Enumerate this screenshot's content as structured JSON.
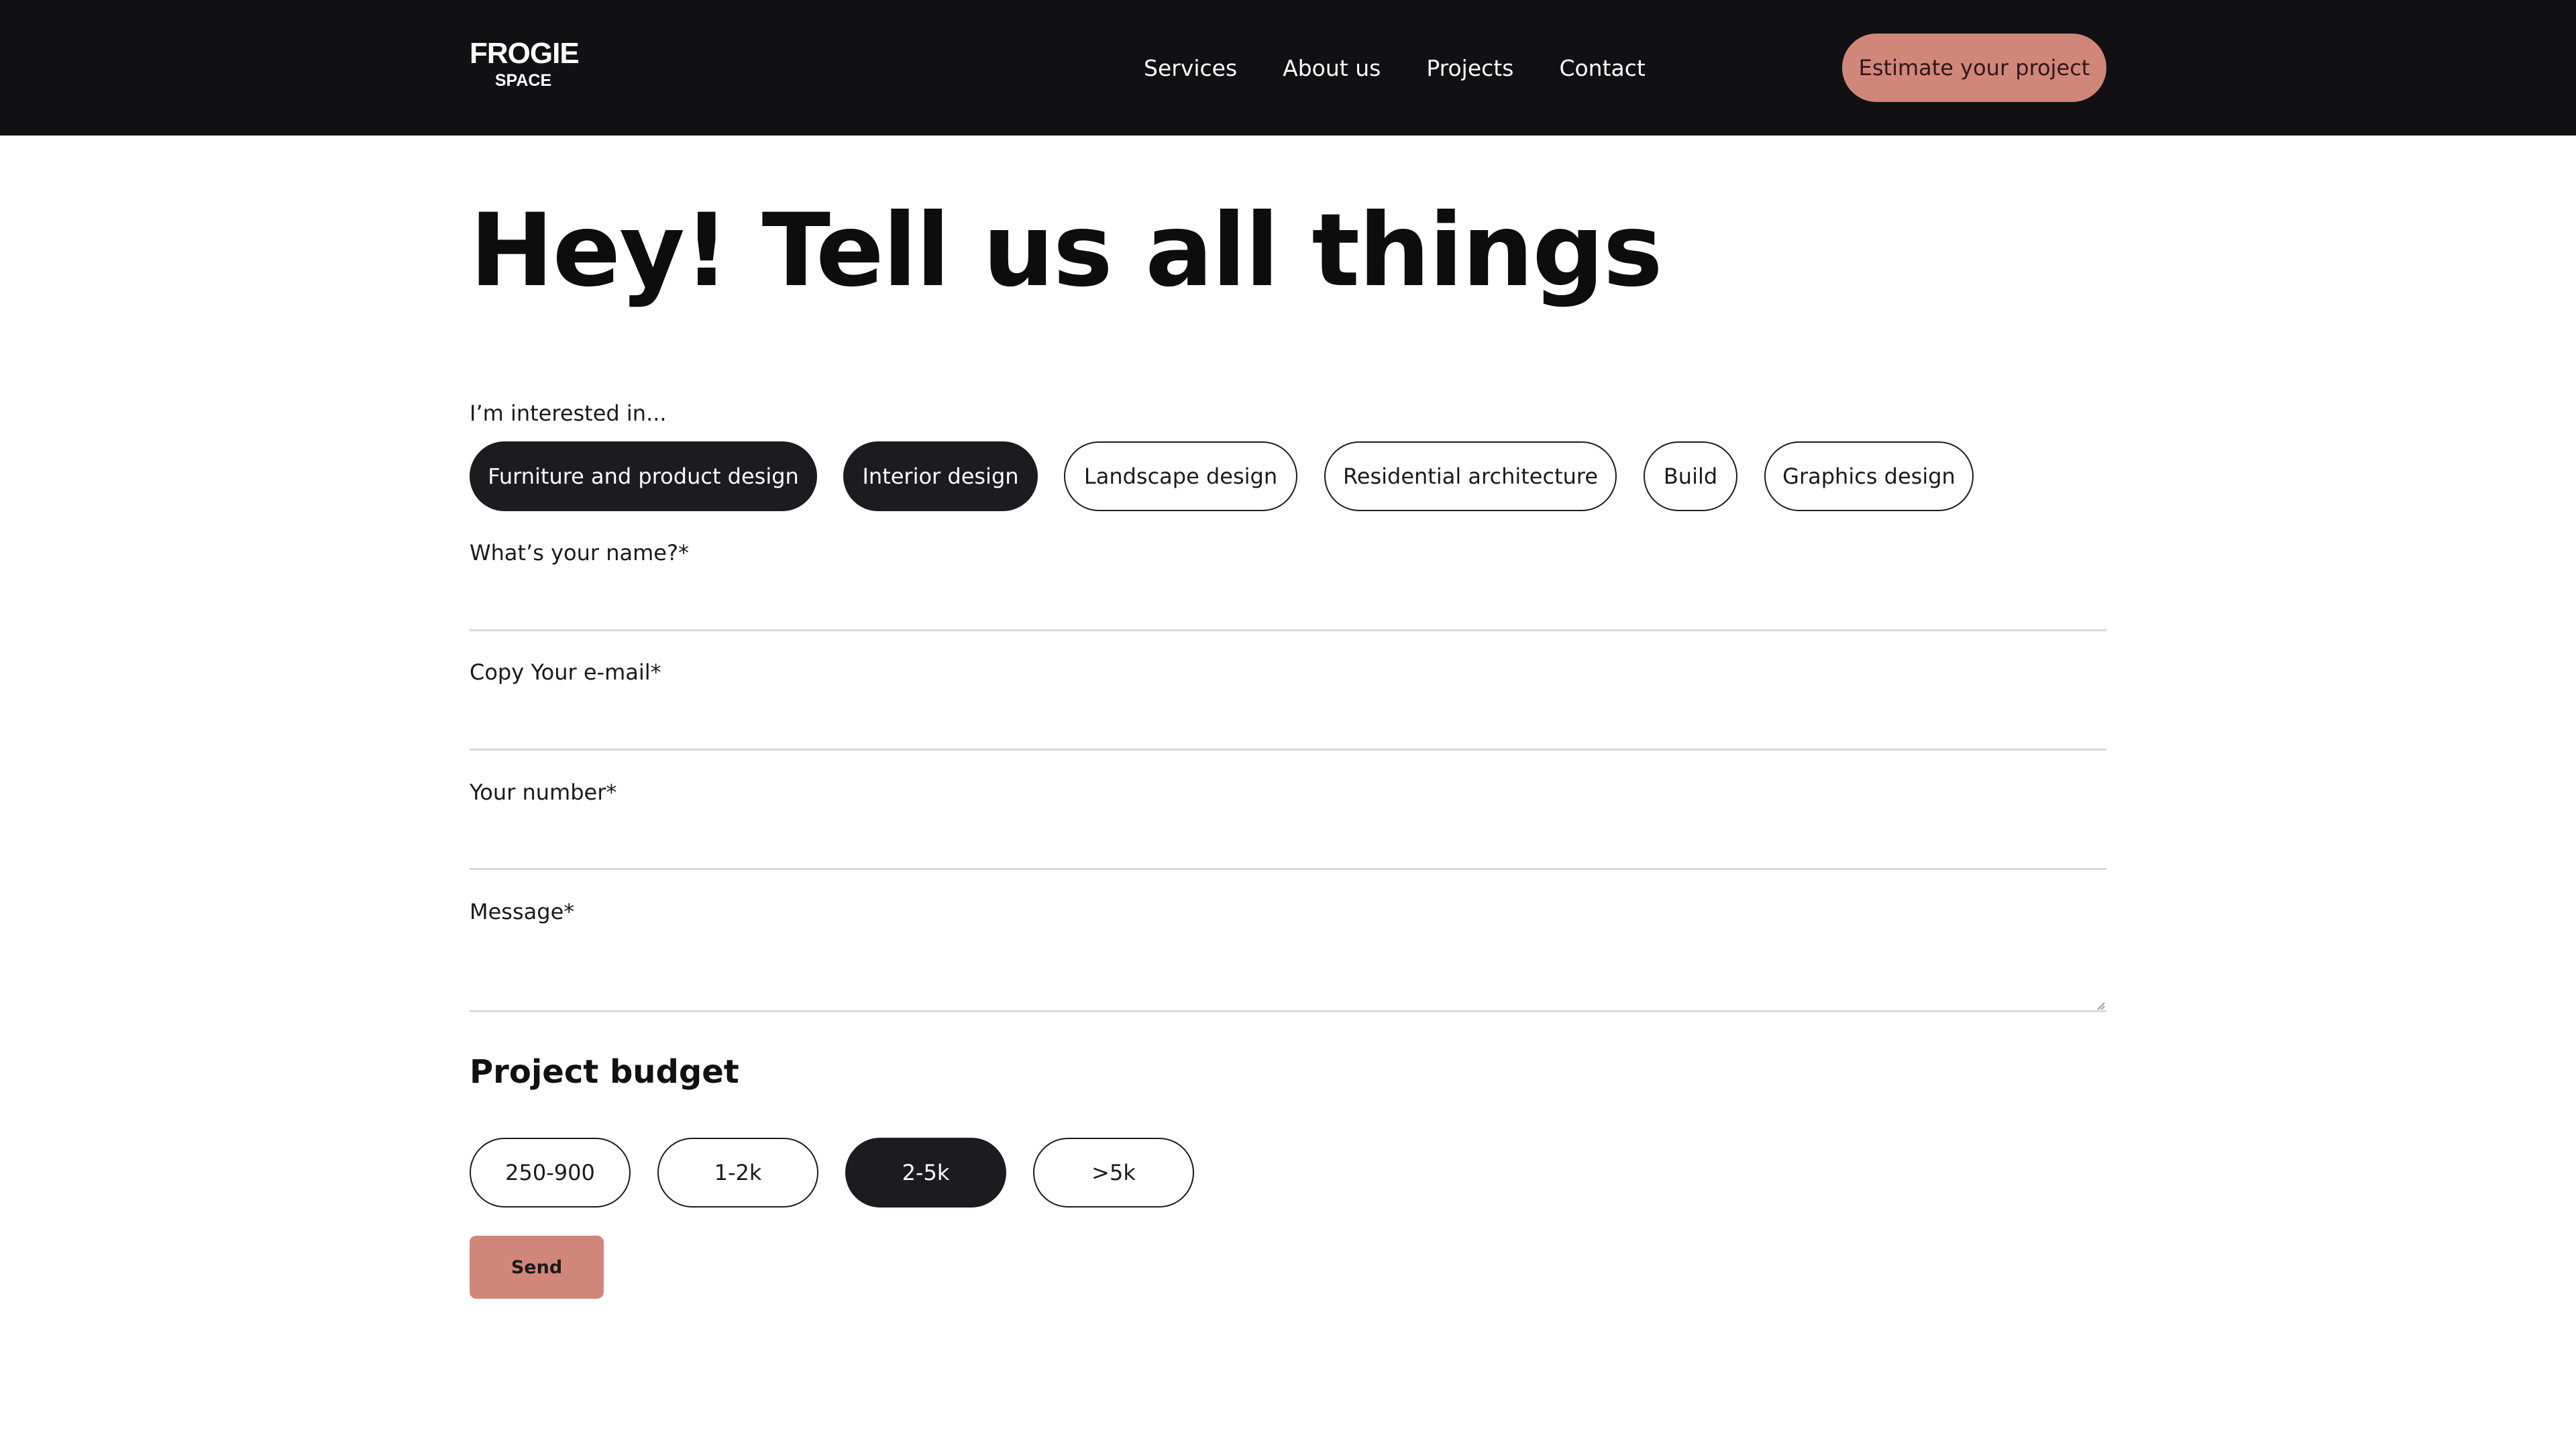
{
  "header": {
    "logo_line1": "FROGIE",
    "logo_line2": "SPACE",
    "nav": [
      "Services",
      "About us",
      "Projects",
      "Contact"
    ],
    "cta_label": "Estimate your project"
  },
  "main": {
    "title": "Hey! Tell us all things",
    "interest_label": "I’m interested in...",
    "interests": [
      {
        "label": "Furniture and product design",
        "selected": true
      },
      {
        "label": "Interior design",
        "selected": true
      },
      {
        "label": "Landscape design",
        "selected": false
      },
      {
        "label": "Residential architecture",
        "selected": false
      },
      {
        "label": "Build",
        "selected": false
      },
      {
        "label": "Graphics design",
        "selected": false
      }
    ],
    "fields": {
      "name_label": "What’s your name?*",
      "name_value": "",
      "email_label": "Copy Your e-mail*",
      "email_value": "",
      "number_label": "Your number*",
      "number_value": "",
      "message_label": "Message*",
      "message_value": ""
    },
    "budget": {
      "title": "Project budget",
      "options": [
        {
          "label": "250-900",
          "selected": false
        },
        {
          "label": "1-2k",
          "selected": false
        },
        {
          "label": "2-5k",
          "selected": true
        },
        {
          "label": ">5k",
          "selected": false
        }
      ]
    },
    "send_label": "Send"
  },
  "colors": {
    "nav_bg": "#111113",
    "accent": "#d1867a",
    "chip_dark": "#1c1c20",
    "divider": "#d9d9d9"
  }
}
